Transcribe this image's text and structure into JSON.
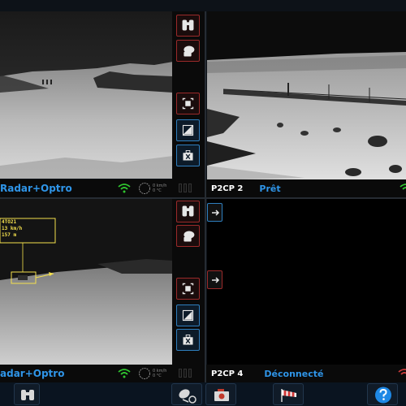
{
  "panels": {
    "p1": {
      "mode_label": "Radar+Optro",
      "speed_line1": "0 km/h",
      "speed_line2": "0 °C"
    },
    "p2": {
      "name": "P2CP 2",
      "state": "Prêt"
    },
    "p3": {
      "mode_label": "adar+Optro",
      "speed_line1": "0 km/h",
      "speed_line2": "0 °C"
    },
    "p4": {
      "name": "P2CP 4",
      "state": "Déconnecté"
    }
  },
  "overlay": {
    "line1": "4TO21",
    "line2": "13 km/h",
    "line3": "157 m"
  },
  "toolbar_icons": {
    "binoculars": "binoculars-icon",
    "ptz": "camera-ptz-icon",
    "fullscreen": "fullscreen-icon",
    "image_settings": "image-settings-icon",
    "toolbox": "toolbox-icon"
  },
  "bottom_icons": [
    "binoculars-icon",
    "satellite-dish-icon",
    "camera-record-icon",
    "windsock-icon",
    "help-icon"
  ],
  "colors": {
    "accent_blue": "#2f95e8",
    "wifi_green": "#2fc62f",
    "border_red": "#9b2a2a",
    "border_blue": "#2f7fbf",
    "overlay_yellow": "#f4e04d"
  }
}
